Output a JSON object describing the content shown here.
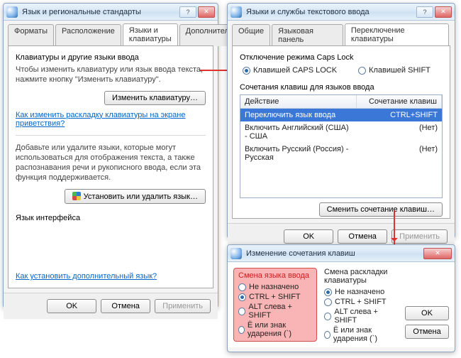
{
  "win1": {
    "title": "Язык и региональные стандарты",
    "tabs": [
      "Форматы",
      "Расположение",
      "Языки и клавиатуры",
      "Дополнительно"
    ],
    "active_tab": 2,
    "section1_title": "Клавиатуры и другие языки ввода",
    "section1_desc": "Чтобы изменить клавиатуру или язык ввода текста, нажмите кнопку \"Изменить клавиатуру\".",
    "btn_change_kb": "Изменить клавиатуру…",
    "link_welcome": "Как изменить раскладку клавиатуры на экране приветствия?",
    "section2_desc": "Добавьте или удалите языки, которые могут использоваться для отображения текста, а также распознавания речи и рукописного ввода, если эта функция поддерживается.",
    "btn_install_lang": "Установить или удалить язык…",
    "section3_title": "Язык интерфейса",
    "link_extra": "Как установить дополнительный язык?",
    "ok": "OK",
    "cancel": "Отмена",
    "apply": "Применить"
  },
  "win2": {
    "title": "Языки и службы текстового ввода",
    "tabs": [
      "Общие",
      "Языковая панель",
      "Переключение клавиатуры"
    ],
    "active_tab": 2,
    "caps_group": "Отключение режима Caps Lock",
    "caps_opt1": "Клавишей CAPS LOCK",
    "caps_opt2": "Клавишей SHIFT",
    "combo_group": "Сочетания клавиш для языков ввода",
    "col_action": "Действие",
    "col_combo": "Сочетание клавиш",
    "rows": [
      {
        "action": "Переключить язык ввода",
        "combo": "CTRL+SHIFT"
      },
      {
        "action": "Включить Английский (США) - США",
        "combo": "(Нет)"
      },
      {
        "action": "Включить Русский (Россия) - Русская",
        "combo": "(Нет)"
      }
    ],
    "btn_change_combo": "Сменить сочетание клавиш…",
    "ok": "OK",
    "cancel": "Отмена",
    "apply": "Применить"
  },
  "win3": {
    "title": "Изменение сочетания клавиш",
    "left_header": "Смена языка ввода",
    "right_header": "Смена раскладки клавиатуры",
    "opt_none": "Не назначено",
    "opt_ctrl_shift": "CTRL + SHIFT",
    "opt_alt_shift": "ALT слева + SHIFT",
    "opt_grave": "Ё или знак ударения (`)",
    "ok": "OK",
    "cancel": "Отмена"
  }
}
